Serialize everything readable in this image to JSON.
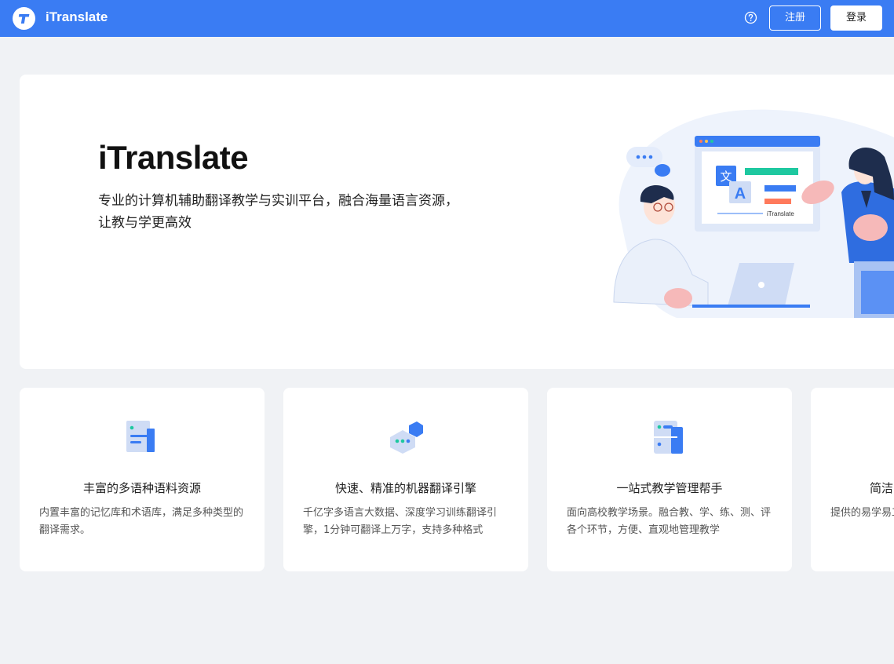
{
  "header": {
    "brand": "iTranslate",
    "register_label": "注册",
    "login_label": "登录"
  },
  "hero": {
    "title": "iTranslate",
    "subtitle_line1": "专业的计算机辅助翻译教学与实训平台，融合海量语言资源，",
    "subtitle_line2": "让教与学更高效",
    "illustration_label": "iTranslate",
    "illustration_glyph_zh": "文",
    "illustration_glyph_en": "A"
  },
  "features": [
    {
      "title": "丰富的多语种语料资源",
      "desc": "内置丰富的记忆库和术语库，满足多种类型的翻译需求。",
      "icon": "document-icon"
    },
    {
      "title": "快速、精准的机器翻译引擎",
      "desc": "千亿字多语言大数据、深度学习训练翻译引擎，1分钟可翻译上万字，支持多种格式",
      "icon": "engine-cube-icon"
    },
    {
      "title": "一站式教学管理帮手",
      "desc": "面向高校教学场景。融合教、学、练、测、评各个环节，方便、直观地管理教学",
      "icon": "management-panel-icon"
    },
    {
      "title": "简洁",
      "desc": "提供的易学易工具的学习成",
      "icon": "simple-icon"
    }
  ],
  "colors": {
    "primary": "#3a7cf3",
    "background": "#f0f2f5",
    "teal": "#1ec8a0"
  }
}
